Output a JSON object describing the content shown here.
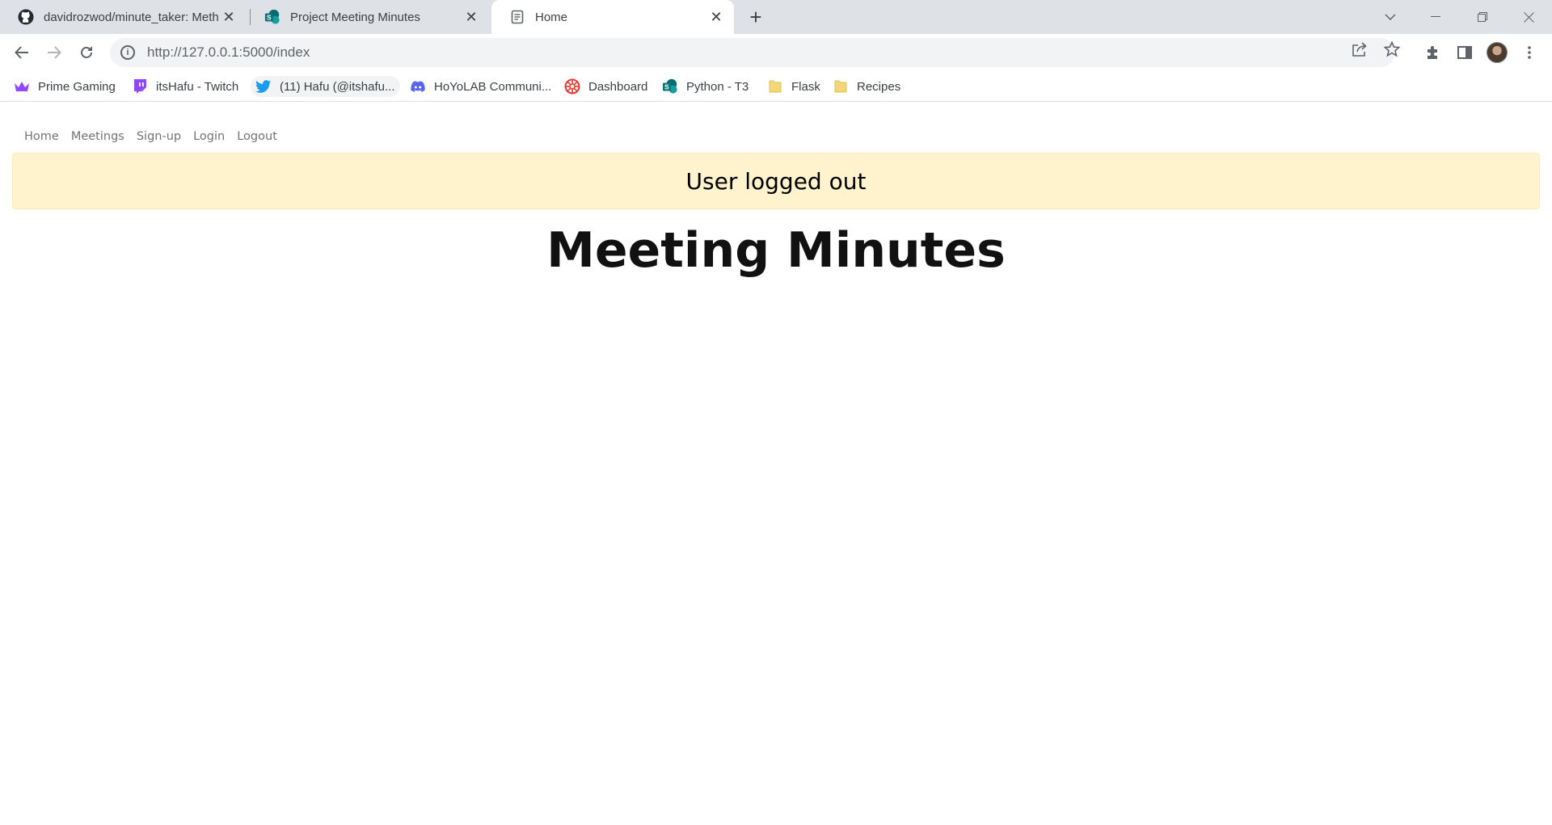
{
  "tabs": [
    {
      "title": "davidrozwod/minute_taker: Meth",
      "icon": "github-icon"
    },
    {
      "title": "Project Meeting Minutes",
      "icon": "sharepoint-icon"
    },
    {
      "title": "Home",
      "icon": "page-icon",
      "active": true
    }
  ],
  "address_bar": {
    "url_host": "http://127.0.0.1",
    "url_rest": ":5000/index"
  },
  "bookmarks": [
    {
      "label": "Prime Gaming",
      "icon": "crown-icon",
      "color": "#9146ff"
    },
    {
      "label": "itsHafu - Twitch",
      "icon": "twitch-icon",
      "color": "#9146ff"
    },
    {
      "label": "(11) Hafu (@itshafu...",
      "icon": "twitter-icon",
      "color": "#1d9bf0"
    },
    {
      "label": "HoYoLAB Communi...",
      "icon": "discord-icon",
      "color": "#5865f2"
    },
    {
      "label": "Dashboard",
      "icon": "dashboard-icon",
      "color": "#e53935"
    },
    {
      "label": "Python - T3",
      "icon": "sharepoint-icon",
      "color": "#038387"
    },
    {
      "label": "Flask",
      "icon": "folder-icon",
      "color": "#f4d774"
    },
    {
      "label": "Recipes",
      "icon": "folder-icon",
      "color": "#f4d774"
    }
  ],
  "site_nav": [
    "Home",
    "Meetings",
    "Sign-up",
    "Login",
    "Logout"
  ],
  "flash_message": "User logged out",
  "page_heading": "Meeting Minutes",
  "colors": {
    "alert_bg": "#fff3cd",
    "tabstrip_bg": "#dee1e6",
    "nav_link": "#737373"
  }
}
